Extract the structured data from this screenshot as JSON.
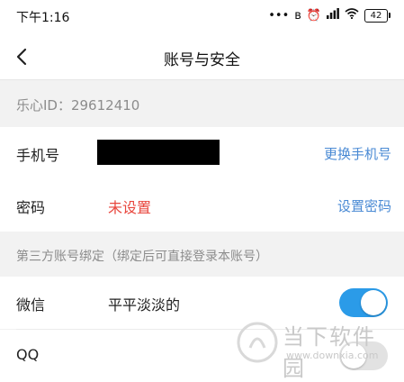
{
  "status_bar": {
    "time": "下午1:16",
    "icons": [
      "more-dots",
      "bluetooth",
      "alarm",
      "signal",
      "wifi"
    ],
    "battery": "42"
  },
  "nav": {
    "title": "账号与安全",
    "back_icon": "chevron-left"
  },
  "account": {
    "id_text": "乐心ID：29612410"
  },
  "phone": {
    "label": "手机号",
    "value": "",
    "action": "更换手机号"
  },
  "password": {
    "label": "密码",
    "value": "未设置",
    "action": "设置密码"
  },
  "third_party": {
    "header": "第三方账号绑定（绑定后可直接登录本账号）",
    "items": [
      {
        "label": "微信",
        "value": "平平淡淡的",
        "enabled": true
      },
      {
        "label": "QQ",
        "value": "",
        "enabled": false
      }
    ]
  },
  "watermark": {
    "name": "当下软件园",
    "url": "www.downxia.com"
  },
  "colors": {
    "accent": "#2b9be8",
    "link": "#4a8ad4",
    "warning": "#e8453c",
    "background": "#f2f2f2"
  }
}
